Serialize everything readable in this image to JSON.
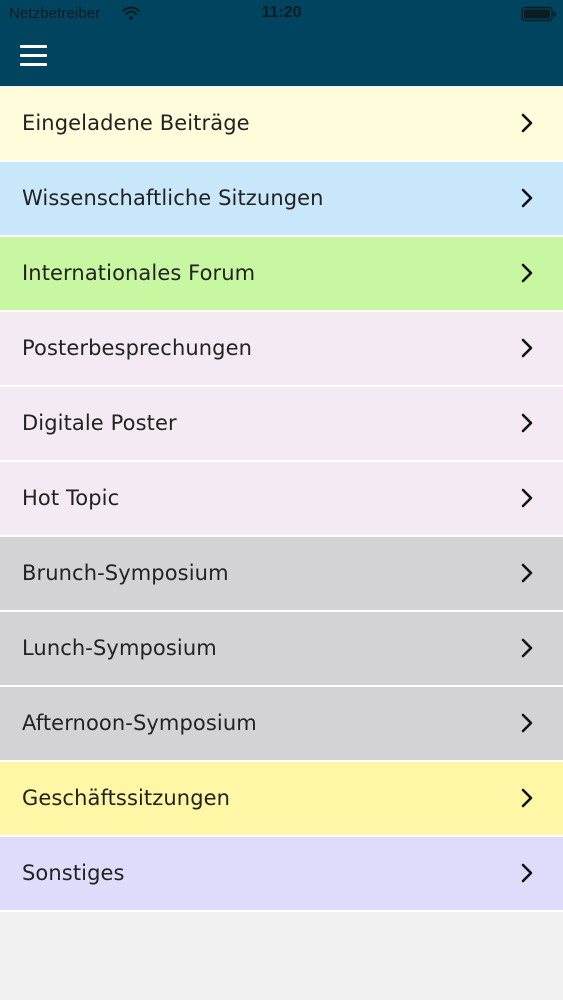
{
  "status_bar": {
    "carrier": "Netzbetreiber",
    "time": "11:20",
    "wifi_icon": "wifi-icon",
    "battery_icon": "battery-icon"
  },
  "header": {
    "menu_icon": "hamburger-menu-icon",
    "background_color": "#004460"
  },
  "menu": {
    "items": [
      {
        "label": "Eingeladene Beiträge",
        "color": "#fffcdb"
      },
      {
        "label": "Wissenschaftliche Sitzungen",
        "color": "#c8e7fa"
      },
      {
        "label": "Internationales Forum",
        "color": "#c7f7a1"
      },
      {
        "label": "Posterbesprechungen",
        "color": "#f4eaf3"
      },
      {
        "label": "Digitale Poster",
        "color": "#f4eaf3"
      },
      {
        "label": "Hot Topic",
        "color": "#f4eaf3"
      },
      {
        "label": "Brunch-Symposium",
        "color": "#d3d3d6"
      },
      {
        "label": "Lunch-Symposium",
        "color": "#d3d3d6"
      },
      {
        "label": "Afternoon-Symposium",
        "color": "#d3d3d6"
      },
      {
        "label": "Geschäftssitzungen",
        "color": "#fff7a6"
      },
      {
        "label": "Sonstiges",
        "color": "#dfdcfb"
      }
    ],
    "chevron_icon": "chevron-right-icon"
  }
}
